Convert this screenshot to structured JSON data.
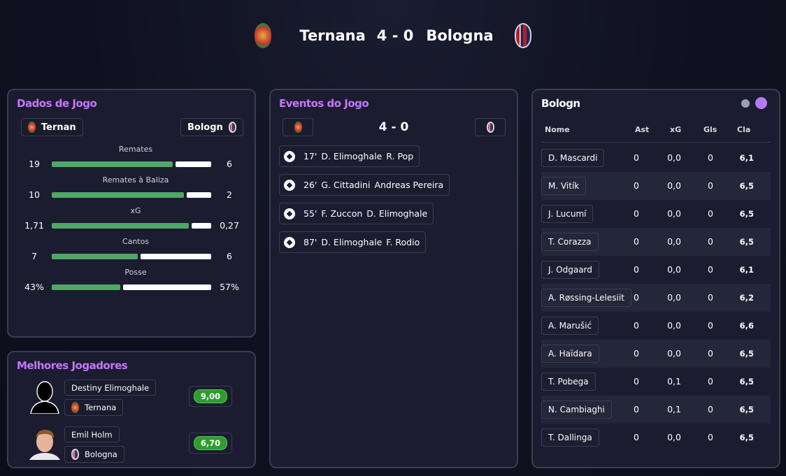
{
  "header": {
    "home": "Ternana",
    "score": "4 - 0",
    "away": "Bologna"
  },
  "stats_panel": {
    "title": "Dados de Jogo",
    "home_chip": "Ternan",
    "away_chip": "Bologn",
    "stats": [
      {
        "label": "Remates",
        "home": "19",
        "away": "6",
        "home_share": 0.76,
        "away_share": 0.24
      },
      {
        "label": "Remates à Baliza",
        "home": "10",
        "away": "2",
        "home_share": 0.83,
        "away_share": 0.17
      },
      {
        "label": "xG",
        "home": "1,71",
        "away": "0,27",
        "home_share": 0.86,
        "away_share": 0.14
      },
      {
        "label": "Cantos",
        "home": "7",
        "away": "6",
        "home_share": 0.54,
        "away_share": 0.46
      },
      {
        "label": "Posse",
        "home": "43%",
        "away": "57%",
        "home_share": 0.43,
        "away_share": 0.57
      }
    ]
  },
  "best_players": {
    "title": "Melhores Jogadores",
    "players": [
      {
        "name": "Destiny Elimoghale",
        "team": "Ternana",
        "rating": "9,00"
      },
      {
        "name": "Emil Holm",
        "team": "Bologna",
        "rating": "6,70"
      }
    ]
  },
  "events": {
    "title": "Eventos do Jogo",
    "score": "4 - 0",
    "items": [
      {
        "minute": "17'",
        "scorer": "D. Elimoghale",
        "assist": "R. Pop"
      },
      {
        "minute": "26'",
        "scorer": "G. Cittadini",
        "assist": "Andreas Pereira"
      },
      {
        "minute": "55'",
        "scorer": "F. Zuccon",
        "assist": "D. Elimoghale"
      },
      {
        "minute": "87'",
        "scorer": "D. Elimoghale",
        "assist": "F. Rodio"
      }
    ]
  },
  "lineup": {
    "title": "Bologn",
    "columns": {
      "name": "Nome",
      "ast": "Ast",
      "xg": "xG",
      "gls": "Gls",
      "cla": "Cla"
    },
    "rows": [
      {
        "name": "D. Mascardi",
        "ast": "0",
        "xg": "0,0",
        "gls": "0",
        "cla": "6,1"
      },
      {
        "name": "M. Vitík",
        "ast": "0",
        "xg": "0,0",
        "gls": "0",
        "cla": "6,5"
      },
      {
        "name": "J. Lucumí",
        "ast": "0",
        "xg": "0,0",
        "gls": "0",
        "cla": "6,5"
      },
      {
        "name": "T. Corazza",
        "ast": "0",
        "xg": "0,0",
        "gls": "0",
        "cla": "6,5"
      },
      {
        "name": "J. Odgaard",
        "ast": "0",
        "xg": "0,0",
        "gls": "0",
        "cla": "6,1"
      },
      {
        "name": "A. Røssing-Lelesiit",
        "ast": "0",
        "xg": "0,0",
        "gls": "0",
        "cla": "6,2"
      },
      {
        "name": "A. Marušić",
        "ast": "0",
        "xg": "0,0",
        "gls": "0",
        "cla": "6,6"
      },
      {
        "name": "A. Haïdara",
        "ast": "0",
        "xg": "0,0",
        "gls": "0",
        "cla": "6,5"
      },
      {
        "name": "T. Pobega",
        "ast": "0",
        "xg": "0,1",
        "gls": "0",
        "cla": "6,5"
      },
      {
        "name": "N. Cambiaghi",
        "ast": "0",
        "xg": "0,1",
        "gls": "0",
        "cla": "6,5"
      },
      {
        "name": "T. Dallinga",
        "ast": "0",
        "xg": "0,0",
        "gls": "0",
        "cla": "6,5"
      }
    ]
  },
  "colors": {
    "accent": "#c874ff",
    "home_bar": "#4fa866",
    "away_bar": "#ffffff",
    "rating": "#2e9d2e"
  }
}
